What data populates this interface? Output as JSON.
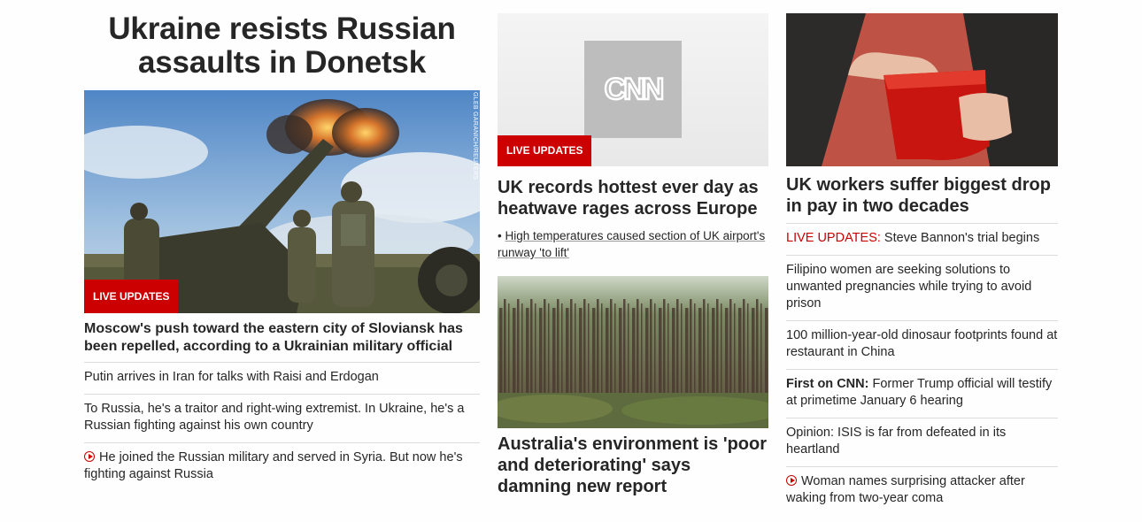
{
  "col1": {
    "title": "Ukraine resists Russian assaults in Donetsk",
    "badge": "LIVE UPDATES",
    "photo_credit": "GLEB GARANICH/REUTERS",
    "lead": "Moscow's push toward the eastern city of Sloviansk has been repelled, according to a Ukrainian military official",
    "items": [
      {
        "text": "Putin arrives in Iran for talks with Raisi and Erdogan"
      },
      {
        "text": "To Russia, he's a traitor and right-wing extremist. In Ukraine, he's a Russian fighting against his own country"
      },
      {
        "text": "He joined the Russian military and served in Syria. But now he's fighting against Russia",
        "icon": "play-video-icon"
      }
    ]
  },
  "col2": {
    "card1": {
      "logo": "CNN",
      "badge": "LIVE UPDATES",
      "title": "UK records hottest ever day as heatwave rages across Europe",
      "sub_bullet": "•",
      "sub": "High temperatures caused section of UK airport's runway 'to lift'"
    },
    "card2": {
      "title": "Australia's environment is 'poor and deteriorating' says damning new report"
    }
  },
  "col3": {
    "title": "UK workers suffer biggest drop in pay in two decades",
    "items": [
      {
        "prefix": "LIVE UPDATES:",
        "text": " Steve Bannon's trial begins"
      },
      {
        "text": "Filipino women are seeking solutions to unwanted pregnancies while trying to avoid prison"
      },
      {
        "text": "100 million-year-old dinosaur footprints found at restaurant in China"
      },
      {
        "prefix": "First on CNN:",
        "text": " Former Trump official will testify at primetime January 6 hearing"
      },
      {
        "text": "Opinion: ISIS is far from defeated in its heartland"
      },
      {
        "text": "Woman names surprising attacker after waking from two-year coma",
        "icon": "play-video-icon"
      }
    ]
  },
  "colors": {
    "accent": "#cc0000",
    "text": "#262626",
    "divider": "#dcdcdc"
  }
}
